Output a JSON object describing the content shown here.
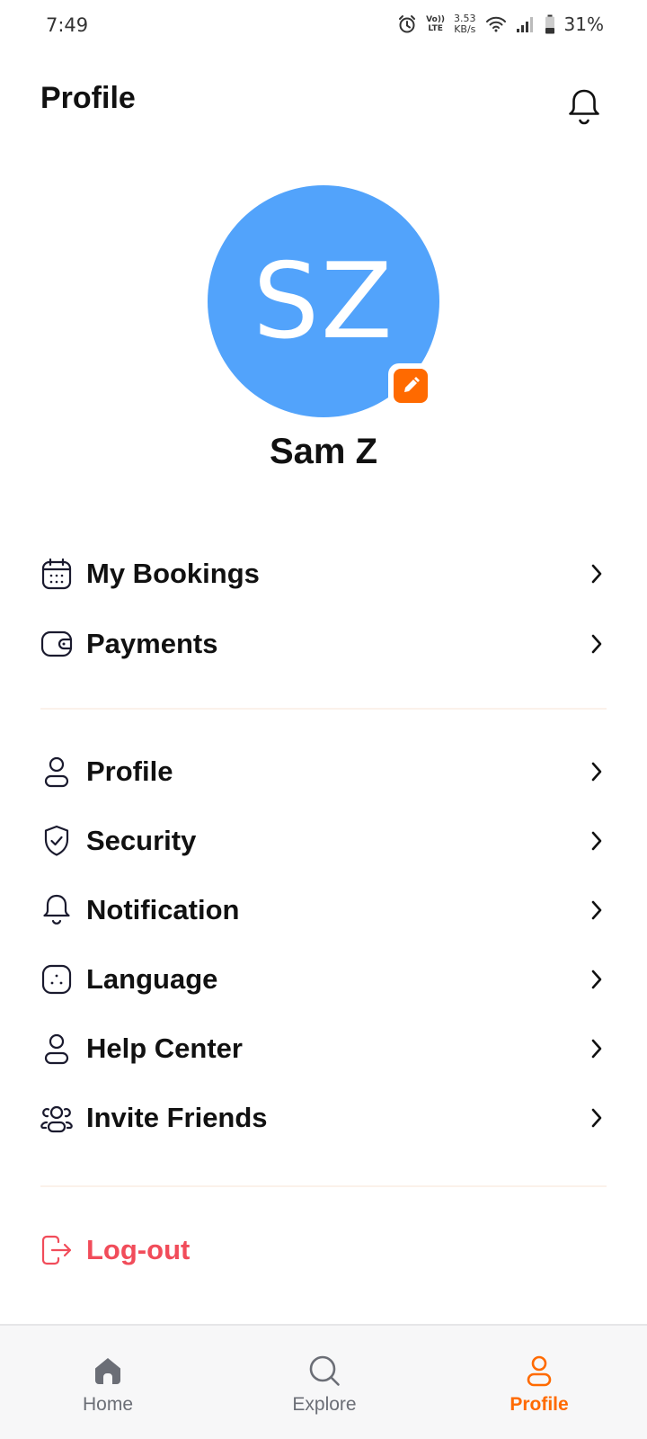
{
  "status_bar": {
    "time": "7:49",
    "volte_top": "Vo))",
    "volte_bottom": "LTE",
    "speed_value": "3.53",
    "speed_unit": "KB/s",
    "battery": "31%"
  },
  "header": {
    "title": "Profile",
    "bell_icon": "bell-icon"
  },
  "profile": {
    "initials": "SZ",
    "name": "Sam Z",
    "avatar_color": "#52a3fb",
    "edit_icon": "pencil-icon"
  },
  "menu": {
    "group1": [
      {
        "label": "My Bookings",
        "icon": "calendar-icon"
      },
      {
        "label": "Payments",
        "icon": "wallet-icon"
      }
    ],
    "group2": [
      {
        "label": "Profile",
        "icon": "user-icon"
      },
      {
        "label": "Security",
        "icon": "shield-check-icon"
      },
      {
        "label": "Notification",
        "icon": "bell-icon"
      },
      {
        "label": "Language",
        "icon": "language-icon"
      },
      {
        "label": "Help Center",
        "icon": "user-icon"
      },
      {
        "label": "Invite Friends",
        "icon": "users-icon"
      }
    ],
    "logout": {
      "label": "Log-out",
      "icon": "logout-icon",
      "color": "#f14c5a"
    }
  },
  "bottom_nav": {
    "items": [
      {
        "label": "Home",
        "icon": "home-icon"
      },
      {
        "label": "Explore",
        "icon": "search-icon"
      },
      {
        "label": "Profile",
        "icon": "user-icon",
        "active": true
      }
    ],
    "active_color": "#ff6a00"
  }
}
